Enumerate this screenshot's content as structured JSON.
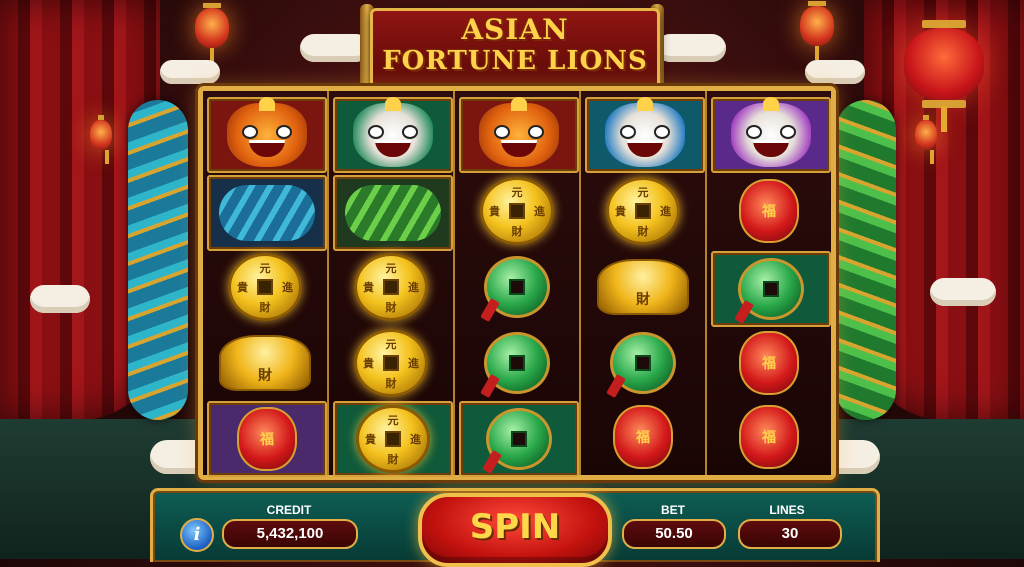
{
  "game": {
    "title_line1": "ASIAN",
    "title_line2": "FORTUNE LIONS"
  },
  "controls": {
    "info_label": "i",
    "credit_label": "CREDIT",
    "credit_value": "5,432,100",
    "spin_label": "SPIN",
    "bet_label": "BET",
    "bet_value": "50.50",
    "lines_label": "LINES",
    "lines_value": "30"
  },
  "symbol_text": {
    "coin_top": "元",
    "coin_left": "貴",
    "coin_right": "進",
    "coin_bottom": "財",
    "ingot": "財",
    "lantern": "福"
  },
  "reels": [
    [
      "lion-orange",
      "dragon-blue",
      "gold-coin",
      "gold-ingot",
      "red-lantern"
    ],
    [
      "lion-green",
      "dragon-green",
      "gold-coin",
      "gold-coin",
      "gold-coin"
    ],
    [
      "lion-orange",
      "gold-coin",
      "jade-coin",
      "jade-coin",
      "jade-coin"
    ],
    [
      "lion-blue",
      "gold-coin",
      "gold-ingot",
      "jade-coin",
      "red-lantern"
    ],
    [
      "lion-purple",
      "red-lantern",
      "jade-coin",
      "red-lantern",
      "red-lantern"
    ]
  ],
  "colors": {
    "frame_gold": "#e0ae45",
    "spin_red": "#c4120f",
    "panel_teal": "#0e5e55"
  }
}
